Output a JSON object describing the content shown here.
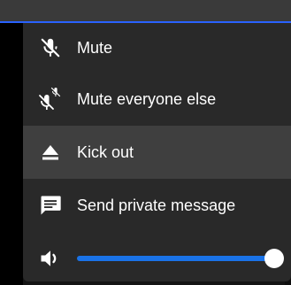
{
  "menu": {
    "items": [
      {
        "label": "Mute",
        "icon": "mic-off-icon"
      },
      {
        "label": "Mute everyone else",
        "icon": "mute-others-icon"
      },
      {
        "label": "Kick out",
        "icon": "eject-icon"
      },
      {
        "label": "Send private message",
        "icon": "chat-icon"
      }
    ],
    "volume": {
      "icon": "volume-icon",
      "level": 1.0
    }
  },
  "colors": {
    "menu_bg": "#292929",
    "hover_bg": "#3f3f3f",
    "accent": "#1a73e8",
    "text": "#ffffff"
  }
}
